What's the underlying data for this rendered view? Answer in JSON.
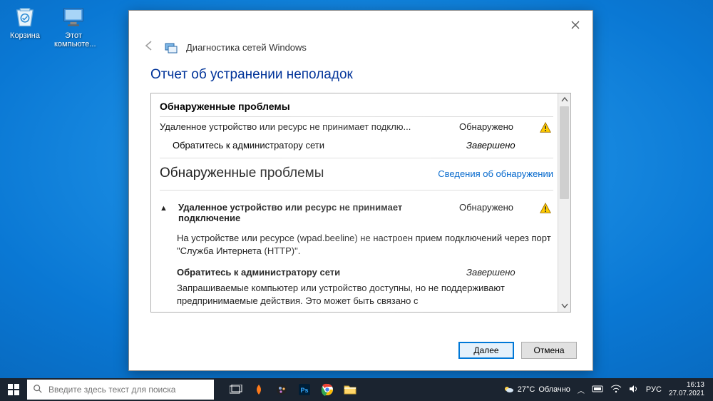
{
  "desktop": {
    "icons": [
      {
        "name": "recycle-bin-icon",
        "label": "Корзина"
      },
      {
        "name": "this-pc-icon",
        "label": "Этот\nкомпьюте..."
      }
    ]
  },
  "window": {
    "wizard_title": "Диагностика сетей Windows",
    "section_title": "Отчет об устранении неполадок",
    "problems_header": "Обнаруженные проблемы",
    "rows": {
      "r1_main": "Удаленное устройство или ресурс не принимает подклю...",
      "r1_status": "Обнаружено",
      "r2_main": "Обратитесь к администратору сети",
      "r2_status": "Завершено"
    },
    "subheader": "Обнаруженные проблемы",
    "details_link": "Сведения об обнаружении",
    "expand": {
      "title": "Удаленное устройство или ресурс не принимает подключение",
      "status": "Обнаружено",
      "desc": "На устройстве или ресурсе (wpad.beeline) не настроен прием подключений через порт \"Служба Интернета (HTTP)\".",
      "sub_title": "Обратитесь к администратору сети",
      "sub_status": "Завершено",
      "sub_desc": "Запрашиваемые компьютер или устройство доступны, но не поддерживают предпринимаемые действия. Это может быть связано с"
    },
    "buttons": {
      "next": "Далее",
      "cancel": "Отмена"
    }
  },
  "taskbar": {
    "search_placeholder": "Введите здесь текст для поиска",
    "weather_temp": "27°C",
    "weather_cond": "Облачно",
    "lang": "РУС",
    "time": "16:13",
    "date": "27.07.2021"
  }
}
